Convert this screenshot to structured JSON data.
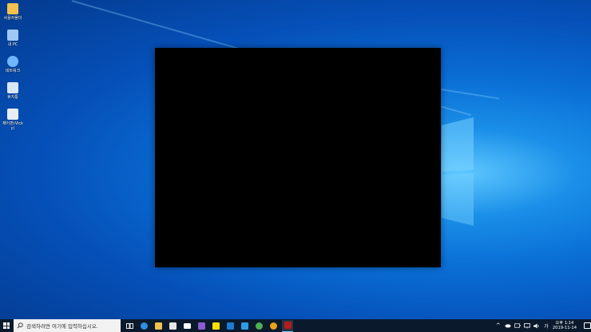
{
  "desktop": {
    "icons": [
      {
        "name": "folder",
        "label": "사용자폴더",
        "color": "#f2c14e"
      },
      {
        "name": "pc",
        "label": "내 PC",
        "color": "#9ec9f5"
      },
      {
        "name": "network",
        "label": "네트워크",
        "color": "#6fb6ff"
      },
      {
        "name": "recycle-bin",
        "label": "휴지통",
        "color": "#d8e6f5"
      },
      {
        "name": "control-panel",
        "label": "제어판(Vicky)",
        "color": "#e8eef5"
      }
    ]
  },
  "taskbar": {
    "search_placeholder": "검색하려면 여기에 입력하십시오.",
    "apps": [
      {
        "name": "task-view",
        "color": "#ffffff"
      },
      {
        "name": "edge",
        "color": "#2e8fe0"
      },
      {
        "name": "file-explorer",
        "color": "#f2c14e"
      },
      {
        "name": "store",
        "color": "#e6e6e6"
      },
      {
        "name": "mail",
        "color": "#ffffff"
      },
      {
        "name": "visual-studio",
        "color": "#8a5cd1"
      },
      {
        "name": "kakaotalk",
        "color": "#f9e000"
      },
      {
        "name": "outlook",
        "color": "#1c7dd6"
      },
      {
        "name": "vscode",
        "color": "#2b9de6"
      },
      {
        "name": "green-app",
        "color": "#4caf50"
      },
      {
        "name": "chrome",
        "color": "#e8a317"
      },
      {
        "name": "active-app",
        "color": "#b71c1c"
      }
    ],
    "clock": {
      "time": "오후 1:14",
      "date": "2019-11-14"
    },
    "tray": {
      "chevron": "^",
      "lang": "가"
    }
  },
  "window": {
    "background": "#000000"
  }
}
